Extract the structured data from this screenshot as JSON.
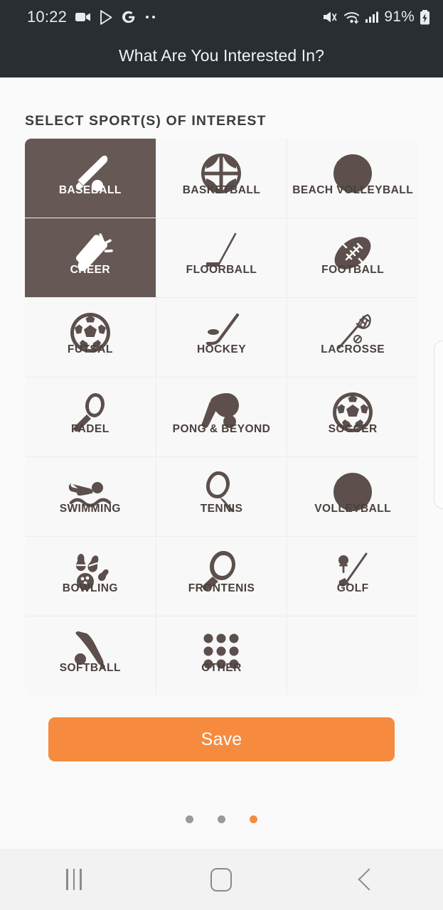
{
  "statusbar": {
    "time": "10:22",
    "battery_percent": "91%",
    "icons": [
      "video-camera-icon",
      "play-store-icon",
      "google-g-icon",
      "more-notifications-icon"
    ],
    "right_icons": [
      "mute-icon",
      "wifi-icon",
      "cellular-signal-icon",
      "battery-charging-icon"
    ]
  },
  "header": {
    "title": "What Are You Interested In?"
  },
  "main": {
    "section_title": "SELECT SPORT(S) OF INTEREST",
    "sports": [
      {
        "label": "BASEBALL",
        "icon": "baseball-bat-icon",
        "selected": true
      },
      {
        "label": "BASKETBALL",
        "icon": "basketball-icon",
        "selected": false
      },
      {
        "label": "BEACH VOLLEYBALL",
        "icon": "volleyball-icon",
        "selected": false
      },
      {
        "label": "CHEER",
        "icon": "megaphone-icon",
        "selected": true
      },
      {
        "label": "FLOORBALL",
        "icon": "floorball-stick-icon",
        "selected": false
      },
      {
        "label": "FOOTBALL",
        "icon": "american-football-icon",
        "selected": false
      },
      {
        "label": "FUTSAL",
        "icon": "futsal-ball-icon",
        "selected": false
      },
      {
        "label": "HOCKEY",
        "icon": "hockey-stick-icon",
        "selected": false
      },
      {
        "label": "LACROSSE",
        "icon": "lacrosse-stick-icon",
        "selected": false
      },
      {
        "label": "PADEL",
        "icon": "padel-racket-icon",
        "selected": false
      },
      {
        "label": "PONG & BEYOND",
        "icon": "ping-pong-paddle-icon",
        "selected": false
      },
      {
        "label": "SOCCER",
        "icon": "soccer-ball-icon",
        "selected": false
      },
      {
        "label": "SWIMMING",
        "icon": "swimmer-icon",
        "selected": false
      },
      {
        "label": "TENNIS",
        "icon": "tennis-racket-icon",
        "selected": false
      },
      {
        "label": "VOLLEYBALL",
        "icon": "volleyball-icon",
        "selected": false
      },
      {
        "label": "BOWLING",
        "icon": "bowling-pins-icon",
        "selected": false
      },
      {
        "label": "FRONTENIS",
        "icon": "frontenis-racket-icon",
        "selected": false
      },
      {
        "label": "GOLF",
        "icon": "golf-club-icon",
        "selected": false
      },
      {
        "label": "SOFTBALL",
        "icon": "softball-bat-icon",
        "selected": false
      },
      {
        "label": "OTHER",
        "icon": "grid-dots-icon",
        "selected": false
      },
      {
        "label": "",
        "icon": "",
        "selected": false
      }
    ],
    "save_label": "Save"
  },
  "pager": {
    "count": 3,
    "active_index": 2
  },
  "navbar": {
    "recents": "recents-button",
    "home": "home-button",
    "back": "back-button"
  },
  "colors": {
    "selected_tile": "#665854",
    "icon_brown": "#5C4F4C",
    "accent_orange": "#F68B3F",
    "header_dark": "#282E32",
    "page_bg": "#FAFAFA"
  }
}
